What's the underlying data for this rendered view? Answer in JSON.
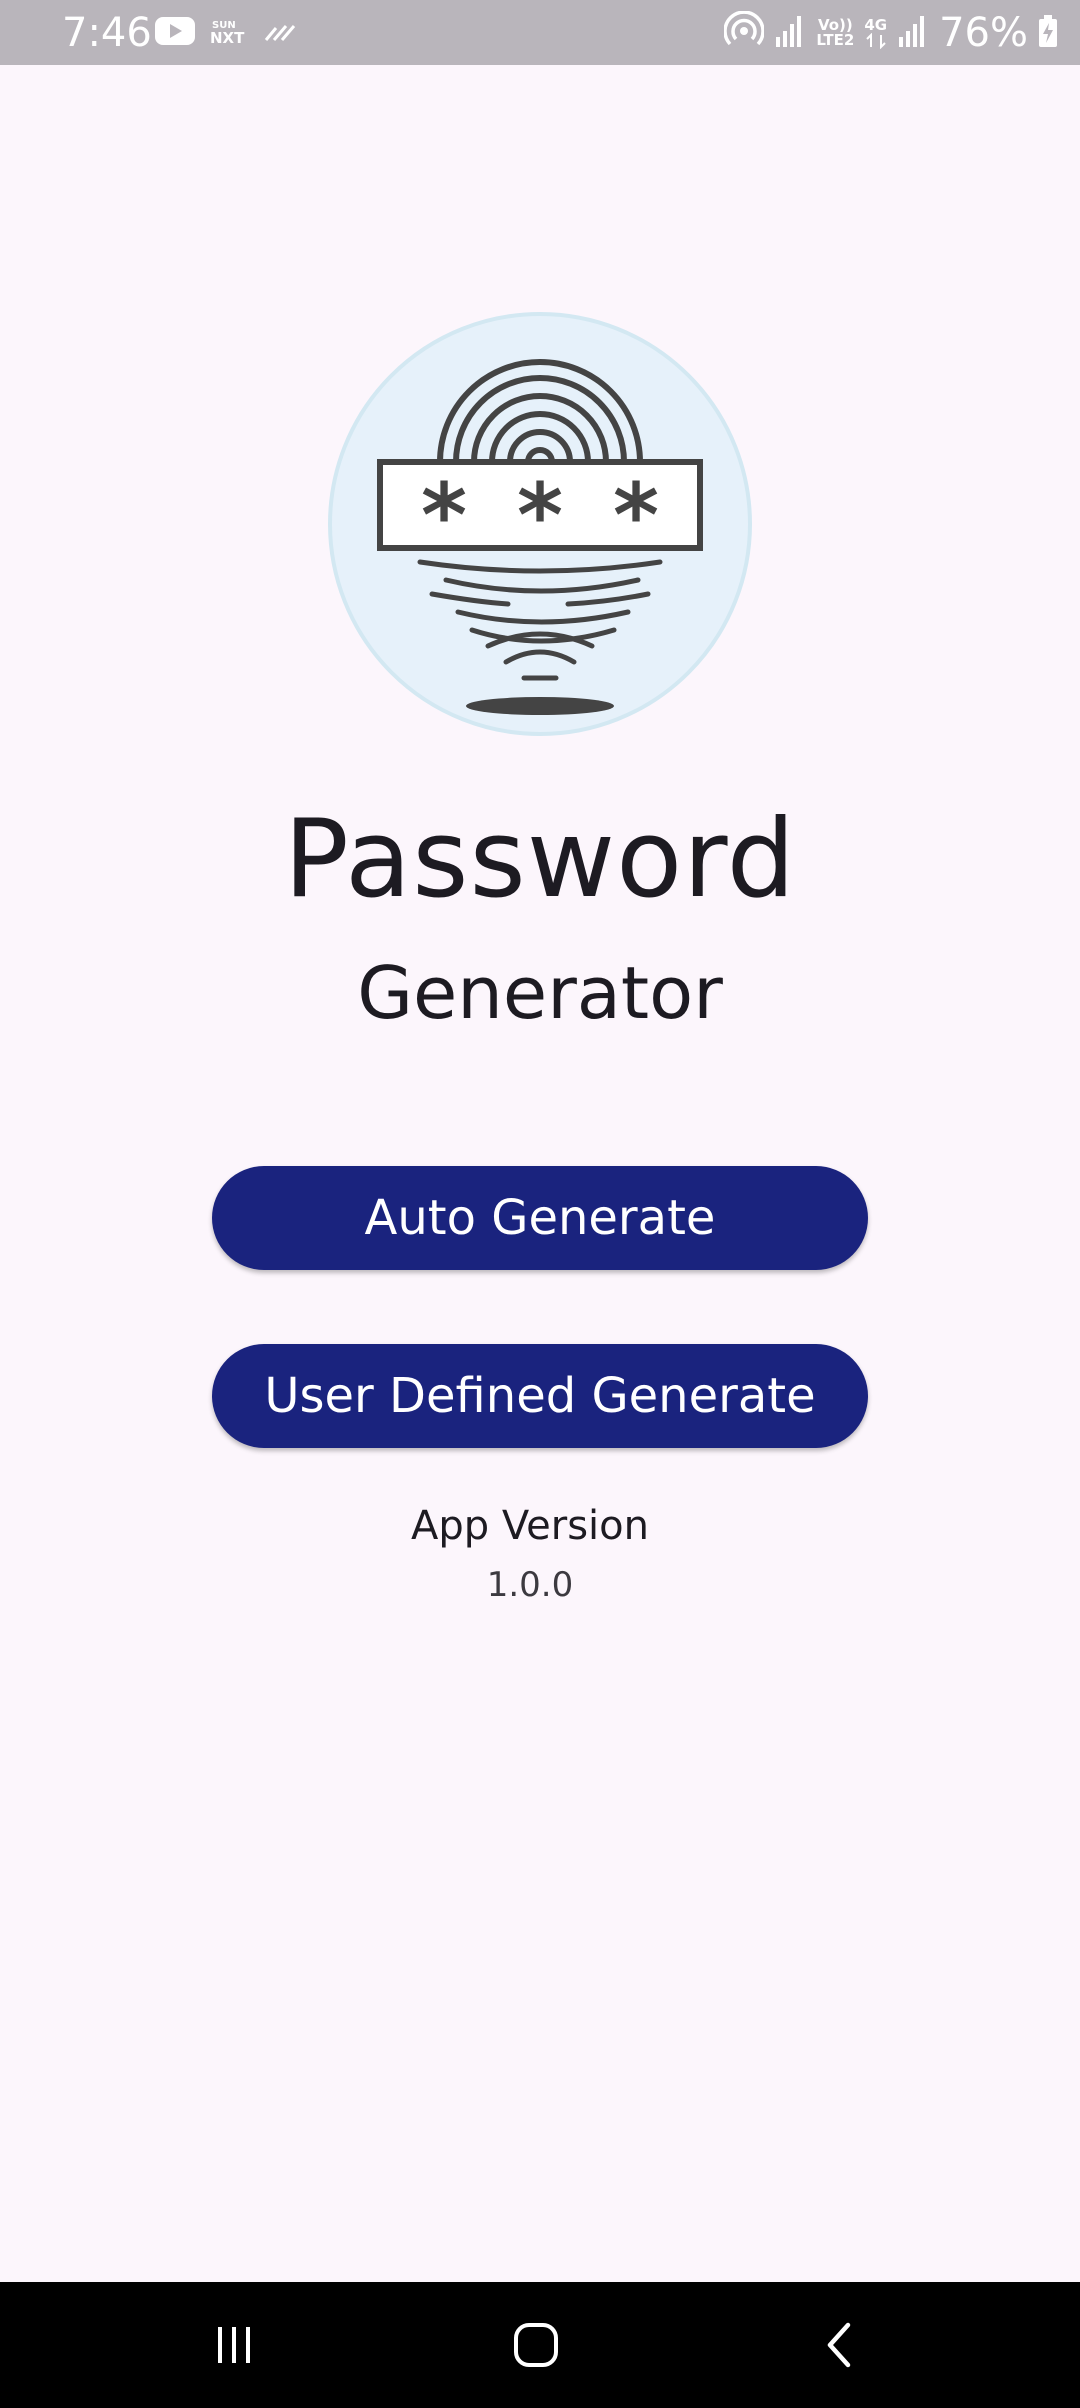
{
  "status_bar": {
    "time": "7:46",
    "battery": "76%",
    "network_label_1": "Vo))",
    "network_label_2": "LTE2",
    "network_type": "4G",
    "icons": [
      "youtube-icon",
      "sun-nxt-icon",
      "missed-signal-icon",
      "hotspot-icon",
      "signal-icon",
      "volte-icon",
      "signal-icon-2",
      "battery-charging-icon"
    ]
  },
  "app": {
    "logo_icon": "fingerprint-password-icon",
    "title": "Password",
    "subtitle": "Generator",
    "auto_generate_label": "Auto Generate",
    "user_defined_label": "User Defined Generate",
    "version_label": "App Version",
    "version_value": "1.0.0"
  },
  "colors": {
    "background": "#fcf6fc",
    "button": "#1a237e",
    "button_text": "#ffffff",
    "logo_circle": "#e6f1fa",
    "status_bar": "#b9b5bb"
  },
  "nav_bar": {
    "icons": [
      "recents-icon",
      "home-icon",
      "back-icon"
    ]
  }
}
